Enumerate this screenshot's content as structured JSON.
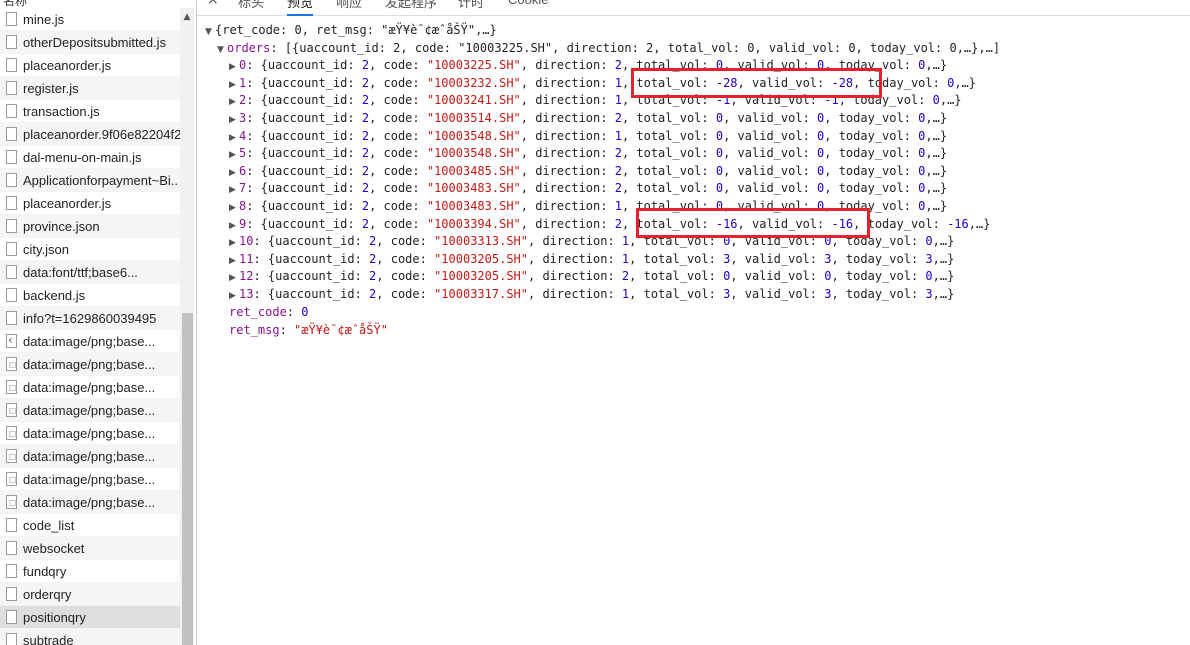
{
  "left_panel": {
    "column_header": "名称",
    "requests": [
      {
        "name": "mine.js",
        "icon": "file-icon"
      },
      {
        "name": "otherDepositsubmitted.js",
        "icon": "file-icon"
      },
      {
        "name": "placeanorder.js",
        "icon": "file-icon"
      },
      {
        "name": "register.js",
        "icon": "file-icon"
      },
      {
        "name": "transaction.js",
        "icon": "file-icon"
      },
      {
        "name": "placeanorder.9f06e82204f2",
        "icon": "file-icon"
      },
      {
        "name": "dal-menu-on-main.js",
        "icon": "file-icon"
      },
      {
        "name": "Applicationforpayment~Bi..",
        "icon": "file-icon"
      },
      {
        "name": "placeanorder.js",
        "icon": "file-icon"
      },
      {
        "name": "province.json",
        "icon": "file-icon"
      },
      {
        "name": "city.json",
        "icon": "file-icon"
      },
      {
        "name": "data:font/ttf;base6...",
        "icon": "file-icon"
      },
      {
        "name": "backend.js",
        "icon": "file-icon"
      },
      {
        "name": "info?t=1629860039495",
        "icon": "file-icon"
      },
      {
        "name": "data:image/png;base...",
        "icon": "arrow-image-icon"
      },
      {
        "name": "data:image/png;base...",
        "icon": "image-icon"
      },
      {
        "name": "data:image/png;base...",
        "icon": "image-icon"
      },
      {
        "name": "data:image/png;base...",
        "icon": "image-icon"
      },
      {
        "name": "data:image/png;base...",
        "icon": "image-icon"
      },
      {
        "name": "data:image/png;base...",
        "icon": "image-icon"
      },
      {
        "name": "data:image/png;base...",
        "icon": "image-icon"
      },
      {
        "name": "data:image/png;base...",
        "icon": "image-icon"
      },
      {
        "name": "code_list",
        "icon": "file-icon"
      },
      {
        "name": "websocket",
        "icon": "file-icon"
      },
      {
        "name": "fundqry",
        "icon": "file-icon"
      },
      {
        "name": "orderqry",
        "icon": "file-icon"
      },
      {
        "name": "positionqry",
        "icon": "file-icon"
      },
      {
        "name": "subtrade",
        "icon": "file-icon"
      }
    ],
    "selected_index": 26
  },
  "tabs": [
    "×",
    "标头",
    "预览",
    "响应",
    "发起程序",
    "计时",
    "Cookie"
  ],
  "active_tab": 2,
  "preview": {
    "root_summary": "{ret_code: 0, ret_msg: \"æŸ¥è¯¢æˆåŠŸ\",…}",
    "orders_key": "orders",
    "orders_summary": "[{uaccount_id: 2, code: \"10003225.SH\", direction: 2, total_vol: 0, valid_vol: 0, today_vol: 0,…},…]",
    "orders": [
      {
        "index": "0",
        "uaccount_id": "2",
        "code": "\"10003225.SH\"",
        "direction": "2",
        "total_vol": "0",
        "valid_vol": "0",
        "today_vol": "0"
      },
      {
        "index": "1",
        "uaccount_id": "2",
        "code": "\"10003232.SH\"",
        "direction": "1",
        "total_vol": "-28",
        "valid_vol": "-28",
        "today_vol": "0"
      },
      {
        "index": "2",
        "uaccount_id": "2",
        "code": "\"10003241.SH\"",
        "direction": "1",
        "total_vol": "-1",
        "valid_vol": "-1",
        "today_vol": "0"
      },
      {
        "index": "3",
        "uaccount_id": "2",
        "code": "\"10003514.SH\"",
        "direction": "2",
        "total_vol": "0",
        "valid_vol": "0",
        "today_vol": "0"
      },
      {
        "index": "4",
        "uaccount_id": "2",
        "code": "\"10003548.SH\"",
        "direction": "1",
        "total_vol": "0",
        "valid_vol": "0",
        "today_vol": "0"
      },
      {
        "index": "5",
        "uaccount_id": "2",
        "code": "\"10003548.SH\"",
        "direction": "2",
        "total_vol": "0",
        "valid_vol": "0",
        "today_vol": "0"
      },
      {
        "index": "6",
        "uaccount_id": "2",
        "code": "\"10003485.SH\"",
        "direction": "2",
        "total_vol": "0",
        "valid_vol": "0",
        "today_vol": "0"
      },
      {
        "index": "7",
        "uaccount_id": "2",
        "code": "\"10003483.SH\"",
        "direction": "2",
        "total_vol": "0",
        "valid_vol": "0",
        "today_vol": "0"
      },
      {
        "index": "8",
        "uaccount_id": "2",
        "code": "\"10003483.SH\"",
        "direction": "1",
        "total_vol": "0",
        "valid_vol": "0",
        "today_vol": "0"
      },
      {
        "index": "9",
        "uaccount_id": "2",
        "code": "\"10003394.SH\"",
        "direction": "2",
        "total_vol": "-16",
        "valid_vol": "-16",
        "today_vol": "-16"
      },
      {
        "index": "10",
        "uaccount_id": "2",
        "code": "\"10003313.SH\"",
        "direction": "1",
        "total_vol": "0",
        "valid_vol": "0",
        "today_vol": "0"
      },
      {
        "index": "11",
        "uaccount_id": "2",
        "code": "\"10003205.SH\"",
        "direction": "1",
        "total_vol": "3",
        "valid_vol": "3",
        "today_vol": "3"
      },
      {
        "index": "12",
        "uaccount_id": "2",
        "code": "\"10003205.SH\"",
        "direction": "2",
        "total_vol": "0",
        "valid_vol": "0",
        "today_vol": "0"
      },
      {
        "index": "13",
        "uaccount_id": "2",
        "code": "\"10003317.SH\"",
        "direction": "1",
        "total_vol": "3",
        "valid_vol": "3",
        "today_vol": "3"
      }
    ],
    "highlighted_orders": [
      "1",
      "9"
    ],
    "ret_code_key": "ret_code",
    "ret_code": "0",
    "ret_msg_key": "ret_msg",
    "ret_msg": "\"æŸ¥è¯¢æˆåŠŸ\"",
    "highlight_color": "#e3222b"
  }
}
